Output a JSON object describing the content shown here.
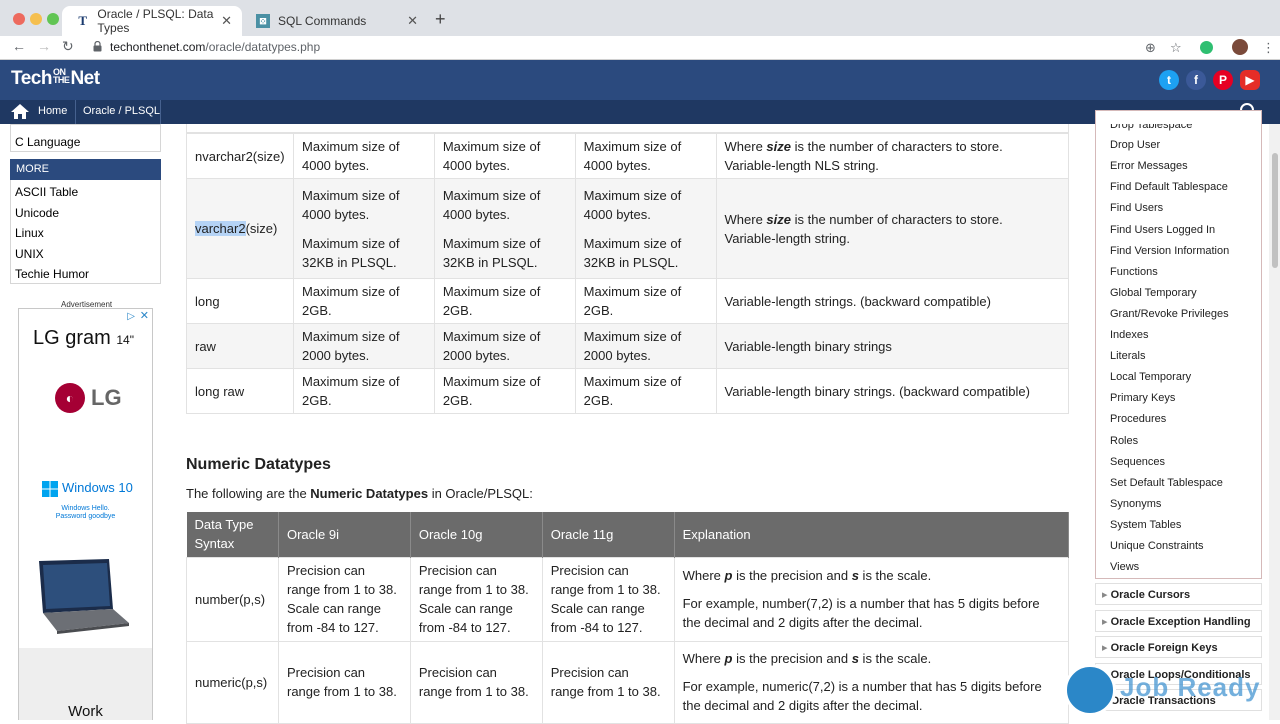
{
  "browser": {
    "tabs": [
      {
        "label": "Oracle / PLSQL: Data Types",
        "active": true
      },
      {
        "label": "SQL Commands",
        "active": false
      }
    ],
    "url_host": "techonthenet.com",
    "url_path": "/oracle/datatypes.php"
  },
  "site": {
    "logo_a": "Tech",
    "logo_on": "ON",
    "logo_the": "THE",
    "logo_b": "Net",
    "nav": [
      "Home",
      "Oracle / PLSQL"
    ]
  },
  "left_sidebar": {
    "top_item": "C Language",
    "more_heading": "MORE",
    "more_items": [
      "ASCII Table",
      "Unicode",
      "Linux",
      "UNIX",
      "Techie Humor"
    ],
    "ad_label": "Advertisement",
    "ad_brand": "LG gram",
    "ad_brand_sup": "14\"",
    "ad_logo": "LG",
    "ad_windows": "Windows 10",
    "ad_windows_sub1": "Windows Hello.",
    "ad_windows_sub2": "Password goodbye",
    "ad_bottom": "Work"
  },
  "char_table": {
    "rows": [
      {
        "syntax": "nvarchar2(size)",
        "c1": [
          "Maximum size of",
          "4000 bytes."
        ],
        "c2": [
          "Maximum size of",
          "4000 bytes."
        ],
        "c3": [
          "Maximum size of",
          "4000 bytes."
        ],
        "exp_pre": "Where ",
        "exp_var": "size",
        "exp_post": " is the number of characters to store.",
        "exp2": "Variable-length NLS string."
      },
      {
        "syntax_hl": "varchar2",
        "syntax_rest": "(size)",
        "c1": [
          "Maximum size of",
          "4000 bytes.",
          "Maximum size of",
          "32KB in PLSQL."
        ],
        "c2": [
          "Maximum size of",
          "4000 bytes.",
          "Maximum size of",
          "32KB in PLSQL."
        ],
        "c3": [
          "Maximum size of",
          "4000 bytes.",
          "Maximum size of",
          "32KB in PLSQL."
        ],
        "exp_pre": "Where ",
        "exp_var": "size",
        "exp_post": " is the number of characters to store.",
        "exp2": "Variable-length string."
      },
      {
        "syntax": "long",
        "c1": [
          "Maximum size of",
          "2GB."
        ],
        "c2": [
          "Maximum size of",
          "2GB."
        ],
        "c3": [
          "Maximum size of",
          "2GB."
        ],
        "exp": "Variable-length strings. (backward compatible)"
      },
      {
        "syntax": "raw",
        "c1": [
          "Maximum size of",
          "2000 bytes."
        ],
        "c2": [
          "Maximum size of",
          "2000 bytes."
        ],
        "c3": [
          "Maximum size of",
          "2000 bytes."
        ],
        "exp": "Variable-length binary strings"
      },
      {
        "syntax": "long raw",
        "c1": [
          "Maximum size of",
          "2GB."
        ],
        "c2": [
          "Maximum size of",
          "2GB."
        ],
        "c3": [
          "Maximum size of",
          "2GB."
        ],
        "exp": "Variable-length binary strings. (backward compatible)"
      }
    ]
  },
  "numeric": {
    "title": "Numeric Datatypes",
    "intro_pre": "The following are the ",
    "intro_bold": "Numeric Datatypes",
    "intro_post": " in Oracle/PLSQL:",
    "headers": [
      "Data Type Syntax",
      "Oracle 9i",
      "Oracle 10g",
      "Oracle 11g",
      "Explanation"
    ],
    "header_syntax_1": "Data Type",
    "header_syntax_2": "Syntax",
    "rows": [
      {
        "syntax": "number(p,s)",
        "prec": [
          "Precision can",
          "range from 1 to 38.",
          "Scale can range",
          "from -84 to 127."
        ],
        "exp_where": "Where ",
        "p": "p",
        "mid": " is the precision and ",
        "s": "s",
        "end": " is the scale.",
        "example1": "For example, number(7,2) is a number that has 5 digits before",
        "example2": "the decimal and 2 digits after the decimal."
      },
      {
        "syntax": "numeric(p,s)",
        "prec": [
          "Precision can",
          "range from 1 to 38."
        ],
        "exp_where": "Where ",
        "p": "p",
        "mid": " is the precision and ",
        "s": "s",
        "end": " is the scale.",
        "example1": "For example, numeric(7,2) is a number that has 5 digits before",
        "example2": "the decimal and 2 digits after the decimal."
      }
    ]
  },
  "right_sidebar": {
    "items": [
      "Drop Tablespace",
      "Drop User",
      "Error Messages",
      "Find Default Tablespace",
      "Find Users",
      "Find Users Logged In",
      "Find Version Information",
      "Functions",
      "Global Temporary",
      "Grant/Revoke Privileges",
      "Indexes",
      "Literals",
      "Local Temporary",
      "Primary Keys",
      "Procedures",
      "Roles",
      "Sequences",
      "Set Default Tablespace",
      "Synonyms",
      "System Tables",
      "Unique Constraints",
      "Views"
    ],
    "categories": [
      "Oracle Cursors",
      "Oracle Exception Handling",
      "Oracle Foreign Keys",
      "Oracle Loops/Conditionals",
      "Oracle Transactions"
    ]
  },
  "watermark": "Job Ready"
}
